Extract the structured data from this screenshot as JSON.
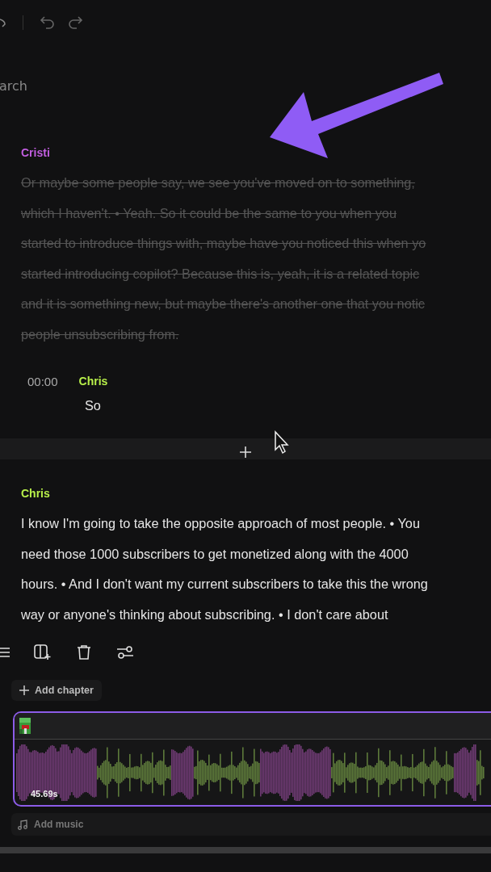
{
  "search": {
    "text": "arch"
  },
  "segments": [
    {
      "speaker": "Cristi",
      "color": "#c25ee0",
      "deleted": true,
      "lines": [
        "Or maybe some people say, we see you've moved on to something,",
        "which I haven't. • Yeah. So it could be the same to you when you",
        "started to introduce things with, maybe have you noticed this when yo",
        "started introducing copilot? Because this is, yeah, it is a related topic",
        "and it is something new, but maybe there's another one that you notic",
        "people unsubscribing from."
      ]
    },
    {
      "time": "00:00",
      "speaker": "Chris",
      "color": "#b8f04a",
      "deleted": false,
      "lines": [
        "So"
      ]
    },
    {
      "speaker": "Chris",
      "color": "#b8f04a",
      "deleted": false,
      "lines": [
        "I know I'm going to take the opposite approach of most people. • You",
        "need those 1000 subscribers to get monetized along with the 4000",
        "hours. • And I don't want my current subscribers to take this the wrong",
        "way or anyone's thinking about subscribing. • I don't care about"
      ]
    }
  ],
  "add_chapter": "Add chapter",
  "track": {
    "duration": "45.69s",
    "selected": true
  },
  "add_music": "Add music"
}
